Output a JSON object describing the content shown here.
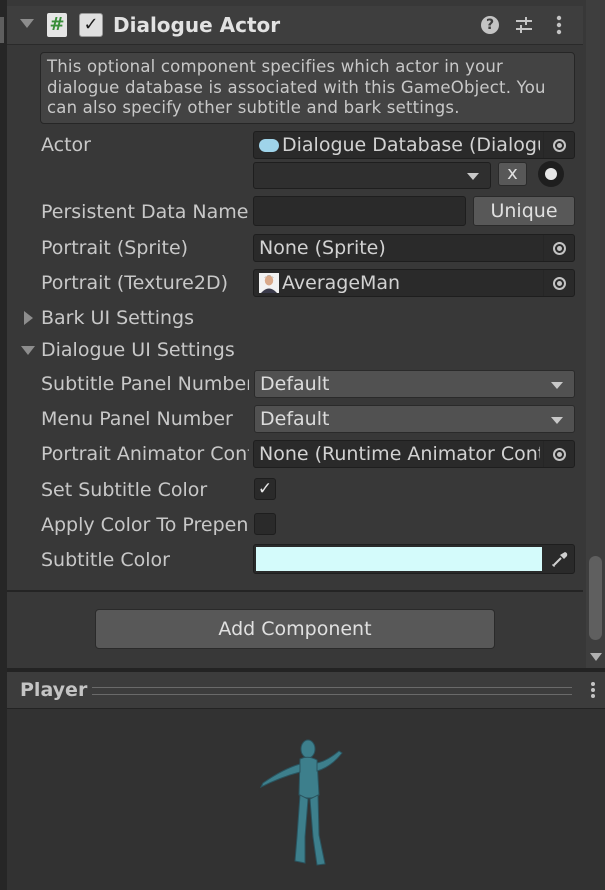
{
  "component": {
    "title": "Dialogue Actor",
    "enabled": true,
    "script_icon_glyph": "#",
    "help_icon_glyph": "?",
    "description": "This optional component specifies which actor in your dialogue database is associated with this GameObject. You can also specify other subtitle and bark settings."
  },
  "fields": {
    "actor_label": "Actor",
    "actor_value": "Dialogue Database (Dialogue Database)",
    "actor_name_dropdown": "",
    "clear_button": "x",
    "persistent_label": "Persistent Data Name",
    "persistent_value": "",
    "unique_button": "Unique",
    "portrait_sprite_label": "Portrait (Sprite)",
    "portrait_sprite_value": "None (Sprite)",
    "portrait_tex_label": "Portrait (Texture2D)",
    "portrait_tex_value": "AverageMan"
  },
  "bark_section": {
    "label": "Bark UI Settings",
    "expanded": false
  },
  "dialogue_section": {
    "label": "Dialogue UI Settings",
    "expanded": true,
    "subtitle_panel_label": "Subtitle Panel Number",
    "subtitle_panel_value": "Default",
    "menu_panel_label": "Menu Panel Number",
    "menu_panel_value": "Default",
    "portrait_animator_label": "Portrait Animator Controller",
    "portrait_animator_value": "None (Runtime Animator Controller)",
    "set_subtitle_color_label": "Set Subtitle Color",
    "set_subtitle_color_checked": true,
    "apply_color_label": "Apply Color To Prepended Name",
    "apply_color_checked": false,
    "subtitle_color_label": "Subtitle Color",
    "subtitle_color_value": "#d4fbfb"
  },
  "add_component_button": "Add Component",
  "preview": {
    "title": "Player"
  },
  "colors": {
    "panel": "#383838",
    "header": "#3e3e3e",
    "field": "#2a2a2a",
    "accent_swatch": "#d4fbfb",
    "figure": "#3d7f8c"
  }
}
